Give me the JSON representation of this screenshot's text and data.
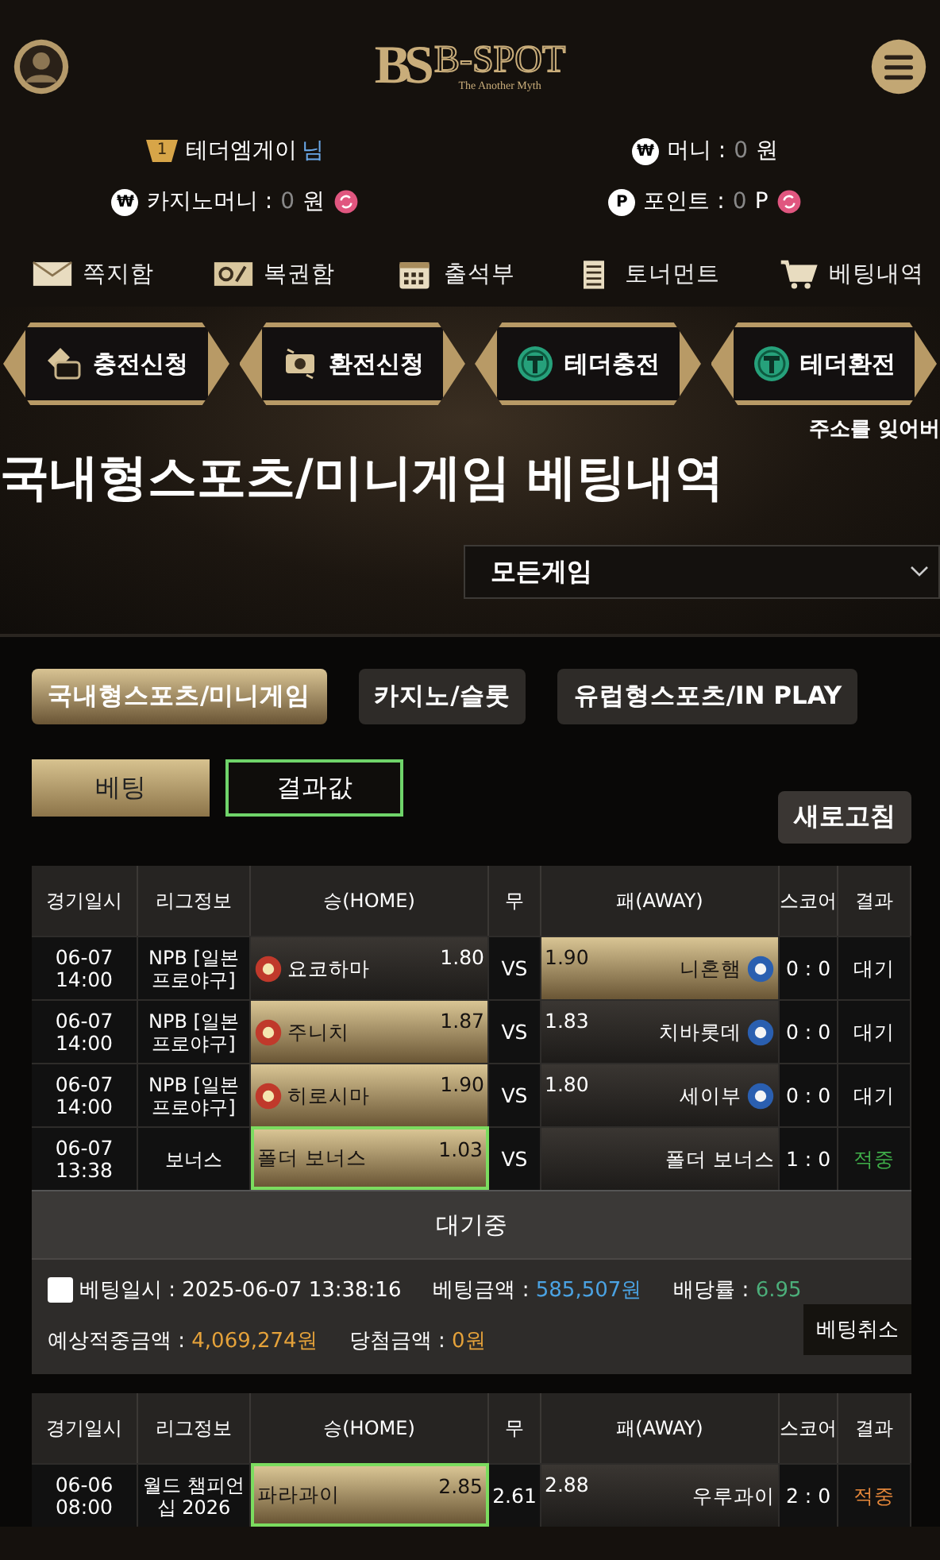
{
  "header": {
    "logo_mark": "BS",
    "logo_text": "B-SPOT",
    "tagline": "The Another Myth"
  },
  "user": {
    "level": "1",
    "name": "테더엠게이",
    "suffix": "님"
  },
  "balances": [
    {
      "icon": "₩",
      "label": "머니 :",
      "value": "0",
      "unit": "원",
      "convert": false
    },
    {
      "icon": "₩",
      "label": "카지노머니 :",
      "value": "0",
      "unit": "원",
      "convert": true
    },
    {
      "icon": "P",
      "label": "포인트 :",
      "value": "0",
      "unit": "P",
      "convert": true
    }
  ],
  "nav": [
    {
      "kind": "mail",
      "label": "쪽지함"
    },
    {
      "kind": "ticket",
      "label": "복권함"
    },
    {
      "kind": "calendar",
      "label": "출석부"
    },
    {
      "kind": "tournament",
      "label": "토너먼트"
    },
    {
      "kind": "cart",
      "label": "베팅내역"
    }
  ],
  "actions": [
    {
      "kind": "deposit",
      "label": "충전신청"
    },
    {
      "kind": "withdraw",
      "label": "환전신청"
    },
    {
      "kind": "tether",
      "label": "테더충전"
    },
    {
      "kind": "tether",
      "label": "테더환전"
    }
  ],
  "notice": "주소를 잊어버",
  "page_title": "국내형스포츠/미니게임 베팅내역",
  "game_select": {
    "value": "모든게임"
  },
  "categories": [
    {
      "label": "국내형스포츠/미니게임",
      "selected": true
    },
    {
      "label": "카지노/슬롯",
      "selected": false
    },
    {
      "label": "유럽형스포츠/IN PLAY",
      "selected": false
    }
  ],
  "subtabs": [
    {
      "label": "베팅",
      "selected": true
    },
    {
      "label": "결과값",
      "selected": false
    }
  ],
  "refresh_button": "새로고침",
  "slips": [
    {
      "columns": [
        "경기일시",
        "리그정보",
        "승(HOME)",
        "무",
        "패(AWAY)",
        "스코어",
        "결과"
      ],
      "rows": [
        {
          "date": "06-07",
          "time": "14:00",
          "league": "NPB [일본 프로야구]",
          "home": {
            "name": "요코하마",
            "odds": "1.80",
            "selected": false,
            "hit": false,
            "logo": true
          },
          "draw": "VS",
          "away": {
            "name": "니혼햄",
            "odds": "1.90",
            "selected": true,
            "hit": false,
            "logo": true
          },
          "score": "0 : 0",
          "result": {
            "text": "대기",
            "color": "#ffffff"
          }
        },
        {
          "date": "06-07",
          "time": "14:00",
          "league": "NPB [일본 프로야구]",
          "home": {
            "name": "주니치",
            "odds": "1.87",
            "selected": true,
            "hit": false,
            "logo": true
          },
          "draw": "VS",
          "away": {
            "name": "치바롯데",
            "odds": "1.83",
            "selected": false,
            "hit": false,
            "logo": true
          },
          "score": "0 : 0",
          "result": {
            "text": "대기",
            "color": "#ffffff"
          }
        },
        {
          "date": "06-07",
          "time": "14:00",
          "league": "NPB [일본 프로야구]",
          "home": {
            "name": "히로시마",
            "odds": "1.90",
            "selected": true,
            "hit": false,
            "logo": true
          },
          "draw": "VS",
          "away": {
            "name": "세이부",
            "odds": "1.80",
            "selected": false,
            "hit": false,
            "logo": true
          },
          "score": "0 : 0",
          "result": {
            "text": "대기",
            "color": "#ffffff"
          }
        },
        {
          "date": "06-07",
          "time": "13:38",
          "league": "보너스",
          "home": {
            "name": "폴더 보너스",
            "odds": "1.03",
            "selected": true,
            "hit": true
          },
          "draw": "VS",
          "away": {
            "name": "폴더 보너스",
            "selected": false,
            "hit": false
          },
          "score": "1 : 0",
          "result": {
            "text": "적중",
            "color": "#3fae49"
          }
        }
      ],
      "status": "대기중",
      "checked": false,
      "info": [
        {
          "label": "베팅일시 :",
          "value": "2025-06-07 13:38:16",
          "color": "#ffffff"
        },
        {
          "label": "베팅금액 :",
          "value": "585,507원",
          "color": "#4ba3e3"
        },
        {
          "label": "배당률 :",
          "value": "6.95",
          "color": "#4cae7a"
        },
        {
          "label": "예상적중금액 :",
          "value": "4,069,274원",
          "color": "#e5a23a"
        },
        {
          "label": "당첨금액 :",
          "value": "0원",
          "color": "#e5a23a"
        }
      ],
      "cancel_button": "베팅취소"
    },
    {
      "columns": [
        "경기일시",
        "리그정보",
        "승(HOME)",
        "무",
        "패(AWAY)",
        "스코어",
        "결과"
      ],
      "rows": [
        {
          "date": "06-06",
          "time": "08:00",
          "league": "월드 챔피언십 2026",
          "home": {
            "name": "파라과이",
            "odds": "2.85",
            "selected": true,
            "hit": true
          },
          "draw": "2.61",
          "away": {
            "name": "우루과이",
            "odds": "2.88",
            "selected": false,
            "hit": false
          },
          "score": "2 : 0",
          "result": {
            "text": "적중",
            "color": "#e5873a"
          }
        }
      ]
    }
  ]
}
